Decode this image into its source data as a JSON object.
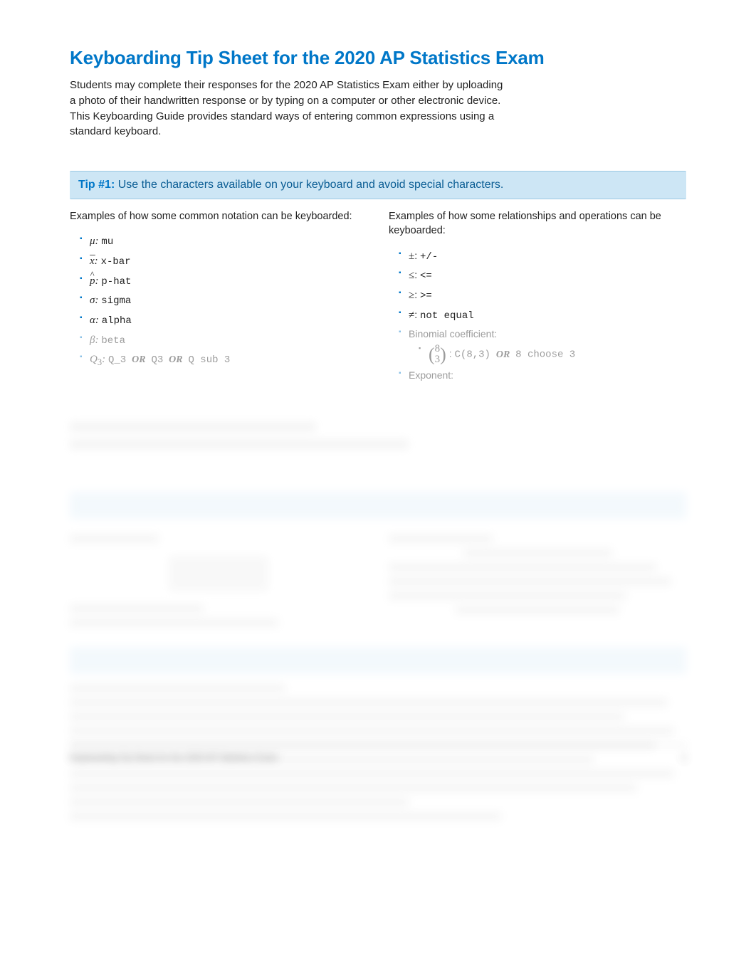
{
  "title": "Keyboarding Tip Sheet for the 2020 AP Statistics Exam",
  "intro": "Students may complete their responses for the 2020 AP Statistics Exam either by uploading a photo of their handwritten response or by typing on a computer or other electronic device. This Keyboarding Guide provides standard ways of entering common expressions using a standard keyboard.",
  "tip1": {
    "label": "Tip #1:",
    "text": "Use the characters available on your keyboard and avoid special characters."
  },
  "left_desc": "Examples of how some common notation can be keyboarded:",
  "right_desc": "Examples of how some relationships and operations can be keyboarded:",
  "notation": {
    "mu": {
      "sym": "μ",
      "kbd": "mu"
    },
    "xbar": {
      "sym_html": "x̄",
      "kbd": "x-bar"
    },
    "phat": {
      "sym_html": "p̂",
      "kbd": "p-hat"
    },
    "sigma": {
      "sym": "σ",
      "kbd": "sigma"
    },
    "alpha": {
      "sym": "α",
      "kbd": "alpha"
    },
    "beta": {
      "sym": "β",
      "kbd": "beta"
    },
    "q3": {
      "sym_html": "Q₃",
      "kbd1": "Q_3",
      "or": "OR",
      "kbd2": "Q3",
      "kbd3": "Q sub 3"
    }
  },
  "ops": {
    "pm": {
      "sym": "±",
      "kbd": "+/-"
    },
    "le": {
      "sym": "≤",
      "kbd": "<="
    },
    "ge": {
      "sym": "≥",
      "kbd": ">="
    },
    "ne": {
      "sym": "≠",
      "kbd": "not equal"
    },
    "binom_label": "Binomial coefficient:",
    "binom": {
      "top": "8",
      "bot": "3",
      "kbd1": "C(8,3)",
      "or": "OR",
      "kbd2": "8 choose 3"
    },
    "exponent_label": "Exponent:"
  },
  "footer": {
    "left": "Keyboarding Tip Sheet for the 2020 AP Statistics Exam",
    "right": "1"
  }
}
